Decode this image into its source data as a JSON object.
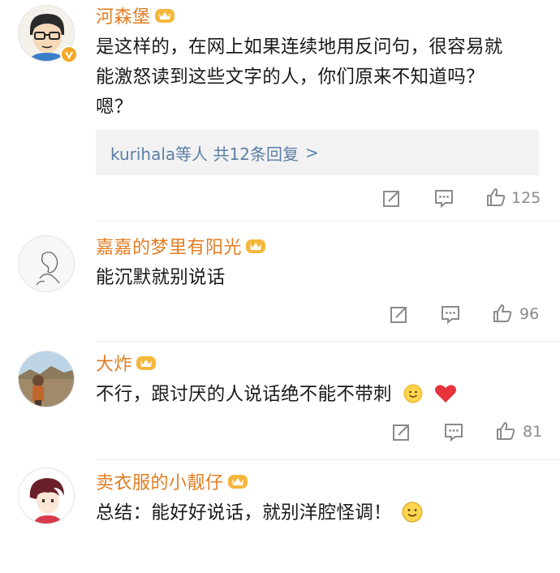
{
  "comments": [
    {
      "username": "河森堡",
      "text_lines": [
        "是这样的，在网上如果连续地用反问句，很容易就",
        "能激怒读到这些文字的人，你们原来不知道吗？",
        "嗯？"
      ],
      "reply_summary": "kurihala等人  共12条回复",
      "reply_arrow": ">",
      "like_count": "125",
      "verified": true
    },
    {
      "username": "嘉嘉的梦里有阳光",
      "text_lines": [
        "能沉默就别说话"
      ],
      "like_count": "96"
    },
    {
      "username": "大炸",
      "text_lines": [
        "不行，跟讨厌的人说话绝不能不带刺"
      ],
      "like_count": "81",
      "trailing_emojis": [
        "smile-emoji",
        "heart-emoji"
      ]
    },
    {
      "username": "卖衣服的小靓仔",
      "text_lines": [
        "总结：能好好说话，就别洋腔怪调！"
      ],
      "trailing_emojis": [
        "smile-emoji"
      ]
    }
  ],
  "icons": {
    "share": "share-icon",
    "comment": "comment-icon",
    "like": "like-icon",
    "member": "member-badge-icon"
  },
  "colors": {
    "username": "#e27d22",
    "reply_link": "#5b7fa6",
    "reply_bg": "#f2f2f2",
    "count": "#8a8a8a"
  }
}
